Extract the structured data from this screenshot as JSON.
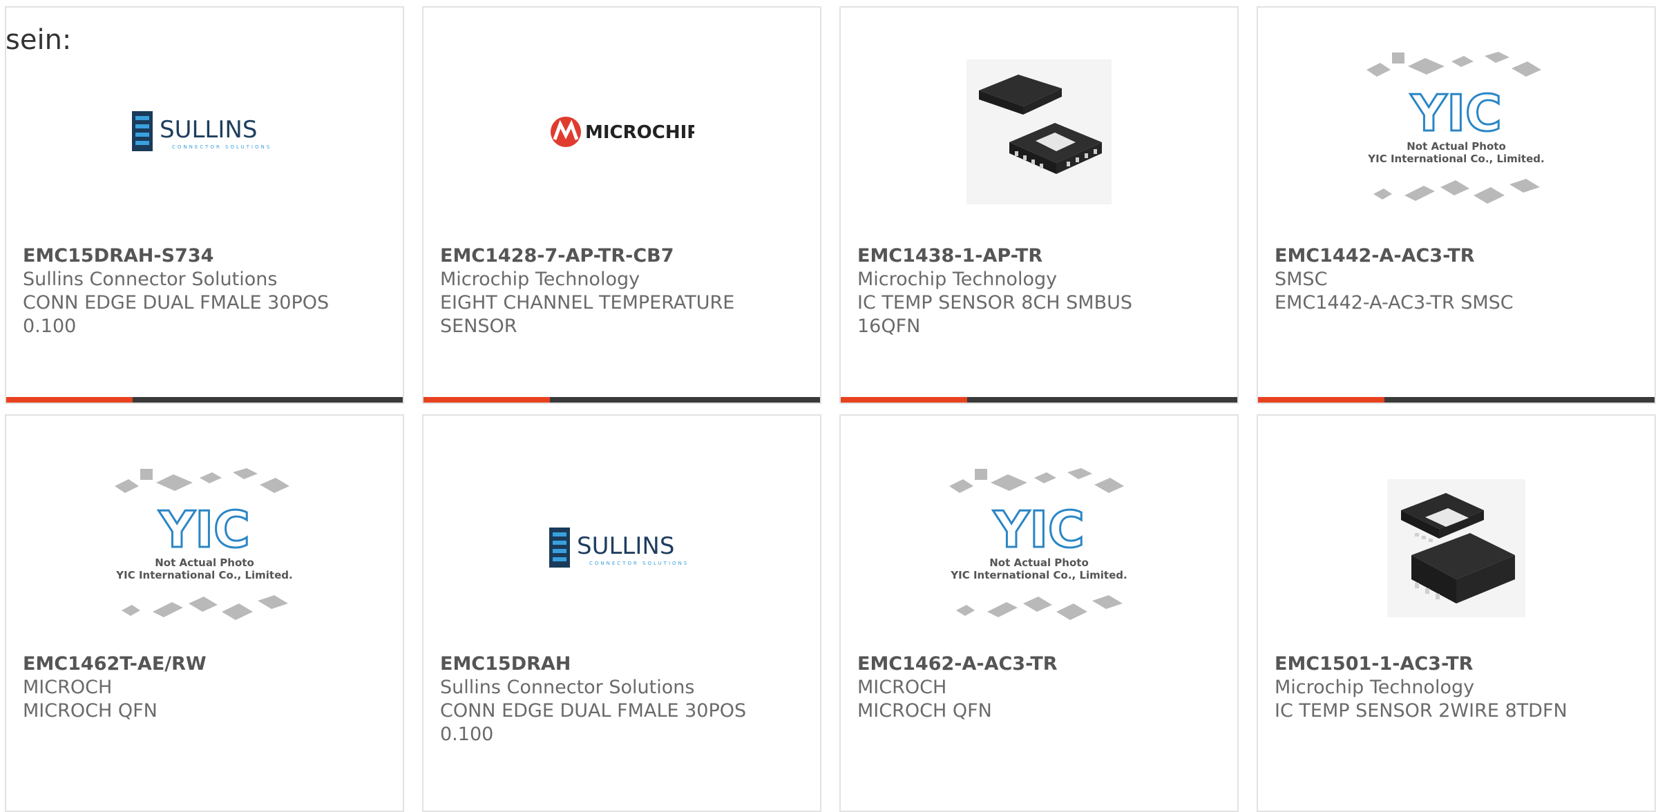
{
  "lead_text": "sein:",
  "colors": {
    "accent": "#e8411f",
    "bar": "#3a3a3a",
    "sullins_blue": "#1e6fa8",
    "microchip_red": "#e03b2f",
    "yic_blue": "#2a86c6"
  },
  "products": [
    {
      "part": "EMC15DRAH-S734",
      "manufacturer": "Sullins Connector Solutions",
      "desc1": "CONN EDGE DUAL FMALE 30POS",
      "desc2": "0.100",
      "image": "sullins-logo"
    },
    {
      "part": "EMC1428-7-AP-TR-CB7",
      "manufacturer": "Microchip Technology",
      "desc1": "EIGHT CHANNEL TEMPERATURE",
      "desc2": "SENSOR",
      "image": "microchip-logo"
    },
    {
      "part": "EMC1438-1-AP-TR",
      "manufacturer": "Microchip Technology",
      "desc1": "IC TEMP SENSOR 8CH SMBUS",
      "desc2": "16QFN",
      "image": "qfn-chip"
    },
    {
      "part": "EMC1442-A-AC3-TR",
      "manufacturer": "SMSC",
      "desc1": "EMC1442-A-AC3-TR SMSC",
      "desc2": "",
      "image": "yic-placeholder"
    },
    {
      "part": "EMC1462T-AE/RW",
      "manufacturer": "MICROCH",
      "desc1": "MICROCH QFN",
      "desc2": "",
      "image": "yic-placeholder"
    },
    {
      "part": "EMC15DRAH",
      "manufacturer": "Sullins Connector Solutions",
      "desc1": "CONN EDGE DUAL FMALE 30POS",
      "desc2": "0.100",
      "image": "sullins-logo"
    },
    {
      "part": "EMC1462-A-AC3-TR",
      "manufacturer": "MICROCH",
      "desc1": "MICROCH QFN",
      "desc2": "",
      "image": "yic-placeholder"
    },
    {
      "part": "EMC1501-1-AC3-TR",
      "manufacturer": "Microchip Technology",
      "desc1": "IC TEMP SENSOR 2WIRE 8TDFN",
      "desc2": "",
      "image": "tdfn-chip"
    }
  ],
  "logos": {
    "sullins_name": "SULLINS",
    "sullins_tagline": "CONNECTOR SOLUTIONS",
    "microchip_name": "MICROCHIP",
    "yic_mark": "YIC",
    "yic_line1": "Not Actual Photo",
    "yic_line2": "YIC International Co., Limited."
  }
}
